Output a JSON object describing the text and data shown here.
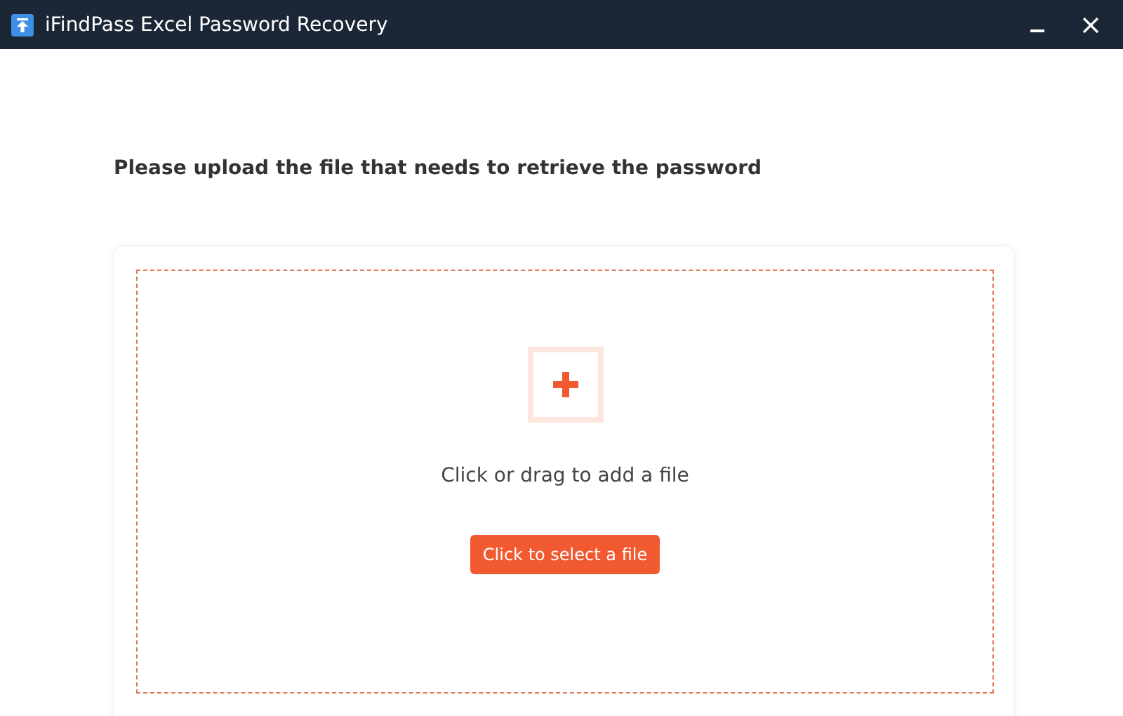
{
  "window": {
    "title": "iFindPass Excel Password Recovery"
  },
  "heading": "Please upload the file that needs to retrieve the password",
  "upload": {
    "hint": "Click or drag to add a file",
    "button": "Click to select a file"
  }
}
